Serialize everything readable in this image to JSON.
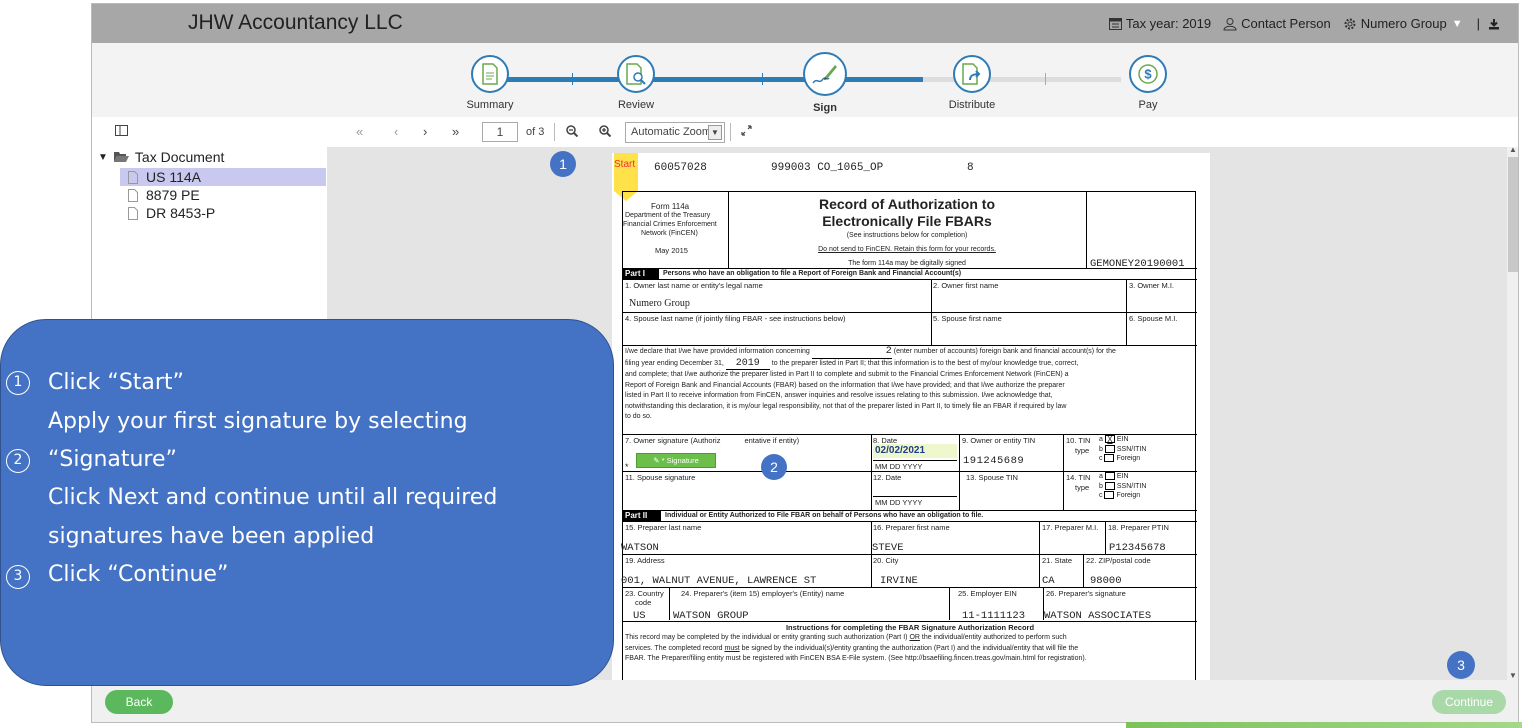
{
  "header": {
    "brand": "JHW Accountancy LLC",
    "tax_year": "Tax year: 2019",
    "contact": "Contact Person",
    "org": "Numero Group"
  },
  "stepper": {
    "steps": [
      {
        "label": "Summary"
      },
      {
        "label": "Review"
      },
      {
        "label": "Sign"
      },
      {
        "label": "Distribute"
      },
      {
        "label": "Pay"
      }
    ]
  },
  "toolbar": {
    "first": "«",
    "prev": "‹",
    "next": "›",
    "last": "»",
    "page": "1",
    "of": "of 3",
    "zoom": "Automatic Zoom"
  },
  "sidebar": {
    "root": "Tax Document",
    "files": [
      "US 114A",
      "8879 PE",
      "DR 8453-P"
    ]
  },
  "badges": {
    "one": "1",
    "two": "2",
    "three": "3"
  },
  "document": {
    "start": "Start",
    "header_line": [
      "60057028",
      "999003 CO_1065_OP",
      "8"
    ],
    "form_no": "Form 114a",
    "dept1": "Department of the Treasury",
    "dept2": "Financial Crimes Enforcement",
    "dept3": "Network (FinCEN)",
    "date_rev": "May 2015",
    "title1": "Record of Authorization to",
    "title2": "Electronically File FBARs",
    "see_instr": "(See instructions below for completion)",
    "do_not_send": "Do not send to FinCEN. Retain this form for your records.",
    "digital": "The form 114a may be digitally signed",
    "id_code": "GEMONEY20190001",
    "part1": "Part I",
    "part1_desc": "Persons who have an obligation to file a Report of Foreign Bank and Financial Account(s)",
    "f1": "1. Owner last name or entity's legal name",
    "f1_val": "Numero Group",
    "f2": "2. Owner first name",
    "f3": "3. Owner M.I.",
    "f4": "4. Spouse last name (if jointly filing FBAR - see instructions below)",
    "f5": "5. Spouse first name",
    "f6": "6. Spouse M.I.",
    "decl1a": "I/we declare that I/we have provided information concerning",
    "decl_count": "2",
    "decl1b": "(enter number of accounts) foreign bank and financial account(s) for the",
    "decl2a": "filing year ending December 31,",
    "decl_year": "2019",
    "decl2b": "to the preparer listed in Part II; that this information is to the best of my/our knowledge true, correct,",
    "decl3": "and complete; that I/we authorize the preparer listed in Part II to complete and submit to the Financial Crimes Enforcement Network (FinCEN) a",
    "decl4": "Report of Foreign Bank and Financial Accounts (FBAR) based on the information that I/we have provided; and that I/we authorize the preparer",
    "decl5": "listed in Part II to receive information from FinCEN, answer inquiries and resolve issues relating to this submission. I/we acknowledge that,",
    "decl6": "notwithstanding this declaration, it is my/our legal responsibility, not that of the preparer listed in Part II, to timely file an FBAR if required by law",
    "decl7": "to do so.",
    "f7a": "7. Owner signature (Authoriz",
    "f7b": "entative if entity)",
    "sig_btn": "* Signature",
    "asterisk": "*",
    "f8": "8. Date",
    "f8_val": "02/02/2021",
    "mmddyyyy": "MM  DD  YYYY",
    "f9": "9. Owner or entity TIN",
    "f9_val": "191245689",
    "f10": "10. TIN",
    "type": "type",
    "a": "a",
    "b": "b",
    "c": "c",
    "x": "X",
    "ein": "EIN",
    "ssn": "SSN/ITIN",
    "foreign": "Foreign",
    "f11": "11. Spouse signature",
    "f12": "12. Date",
    "f13": "13. Spouse TIN",
    "f14": "14. TIN",
    "part2": "Part II",
    "part2_desc": "Individual or Entity Authorized to File FBAR on behalf of Persons who have an obligation to file.",
    "f15": "15. Preparer last name",
    "f15_val": "WATSON",
    "f16": "16. Preparer first name",
    "f16_val": "STEVE",
    "f17": "17. Preparer M.I.",
    "f18": "18. Preparer PTIN",
    "f18_val": "P12345678",
    "f19": "19. Address",
    "f19_val": "001, WALNUT AVENUE, LAWRENCE ST",
    "f20": "20. City",
    "f20_val": "IRVINE",
    "f21": "21. State",
    "f21_val": "CA",
    "f22": "22. ZIP/postal code",
    "f22_val": "98000",
    "f23": "23. Country",
    "f23b": "code",
    "f23_val": "US",
    "f24": "24. Preparer's (item 15) employer's (Entity) name",
    "f24_val": "WATSON GROUP",
    "f25": "25. Employer EIN",
    "f25_val": "11-1111123",
    "f26": "26. Preparer's signature",
    "f26_val": "WATSON ASSOCIATES",
    "instr_title": "Instructions for completing the FBAR Signature Authorization Record",
    "instr1a": "This record may be completed by the individual or entity granting such authorization (Part I)",
    "instr1_or": "OR",
    "instr1b": "the individual/entity authorized to perform such",
    "instr2a": "services. The completed record",
    "instr2_must": "must",
    "instr2b": "be signed by the individual(s)/entity granting the authorization (Part I) and the individual/entity that will file the",
    "instr3": "FBAR. The Preparer/filing entity must be registered with FinCEN BSA E-File system. (See http://bsaefiling.fincen.treas.gov/main.html for registration)."
  },
  "callout": {
    "n1": "1",
    "n2": "2",
    "n3": "3",
    "l1": "Click “Start”",
    "l2": "Apply your first signature by selecting",
    "l3": "“Signature”",
    "l4": "Click Next and continue until all required",
    "l5": "signatures have been applied",
    "l6": "Click “Continue”"
  },
  "footer": {
    "back": "Back",
    "continue": "Continue"
  },
  "colors": {
    "header": "#a7a7a7",
    "accent": "#2e7bb6",
    "callout": "#4472c4",
    "button": "#5cb85c"
  }
}
